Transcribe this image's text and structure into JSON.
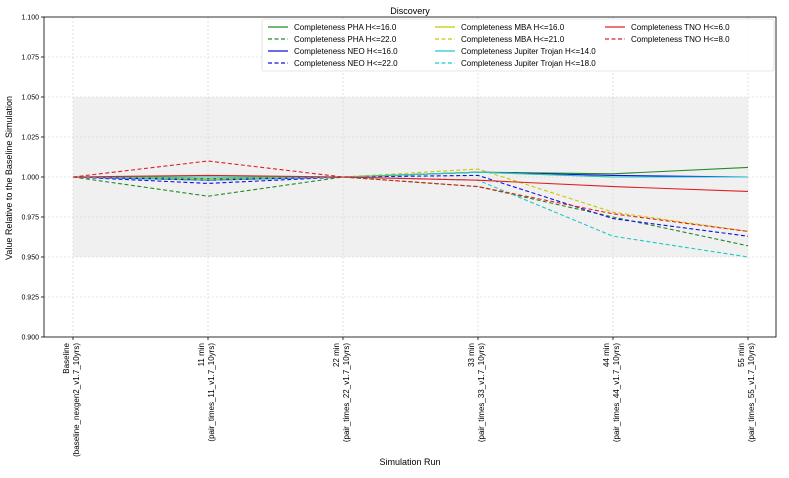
{
  "chart_data": {
    "type": "line",
    "title": "Discovery",
    "xlabel": "Simulation Run",
    "ylabel": "Value Relative to the Baseline Simulation",
    "ylim": [
      0.9,
      1.1
    ],
    "yticks": [
      "0.900",
      "0.925",
      "0.950",
      "0.975",
      "1.000",
      "1.025",
      "1.050",
      "1.075",
      "1.100"
    ],
    "grid": true,
    "band": [
      0.95,
      1.05
    ],
    "band_color": "#f0f0f0",
    "legend_position": "top-right",
    "categories": [
      [
        "Baseline",
        "(baseline_nexgen2_v1.7_10yrs)"
      ],
      [
        "11 min",
        "(pair_times_11_v1.7_10yrs)"
      ],
      [
        "22 min",
        "(pair_times_22_v1.7_10yrs)"
      ],
      [
        "33 min",
        "(pair_times_33_v1.7_10yrs)"
      ],
      [
        "44 min",
        "(pair_times_44_v1.7_10yrs)"
      ],
      [
        "55 min",
        "(pair_times_55_v1.7_10yrs)"
      ]
    ],
    "series": [
      {
        "name": "Completeness PHA H<=16.0",
        "color": "#228b22",
        "dash": false,
        "values": [
          1.0,
          0.999,
          1.0,
          1.003,
          1.002,
          1.006
        ]
      },
      {
        "name": "Completeness PHA H<=22.0",
        "color": "#228b22",
        "dash": true,
        "values": [
          1.0,
          0.988,
          1.0,
          0.994,
          0.975,
          0.957
        ]
      },
      {
        "name": "Completeness NEO H<=16.0",
        "color": "#1010e0",
        "dash": false,
        "values": [
          1.0,
          0.998,
          1.0,
          1.003,
          1.001,
          1.0
        ]
      },
      {
        "name": "Completeness NEO H<=22.0",
        "color": "#1010e0",
        "dash": true,
        "values": [
          1.0,
          0.996,
          1.0,
          1.001,
          0.974,
          0.963
        ]
      },
      {
        "name": "Completeness MBA H<=16.0",
        "color": "#c8c800",
        "dash": false,
        "values": [
          1.0,
          1.0,
          1.0,
          1.003,
          1.0,
          1.0
        ]
      },
      {
        "name": "Completeness MBA H<=21.0",
        "color": "#c8c800",
        "dash": true,
        "values": [
          1.0,
          0.999,
          1.0,
          1.005,
          0.978,
          0.966
        ]
      },
      {
        "name": "Completeness Jupiter Trojan H<=14.0",
        "color": "#20c8c8",
        "dash": false,
        "values": [
          1.0,
          1.0,
          1.0,
          1.003,
          1.0,
          1.0
        ]
      },
      {
        "name": "Completeness Jupiter Trojan H<=18.0",
        "color": "#20c8c8",
        "dash": true,
        "values": [
          1.0,
          0.998,
          1.0,
          0.998,
          0.963,
          0.95
        ]
      },
      {
        "name": "Completeness TNO H<=6.0",
        "color": "#e02020",
        "dash": false,
        "values": [
          1.0,
          1.001,
          1.0,
          0.998,
          0.994,
          0.991
        ]
      },
      {
        "name": "Completeness TNO H<=8.0",
        "color": "#e02020",
        "dash": true,
        "values": [
          1.0,
          1.01,
          1.0,
          0.994,
          0.977,
          0.966
        ]
      }
    ]
  }
}
